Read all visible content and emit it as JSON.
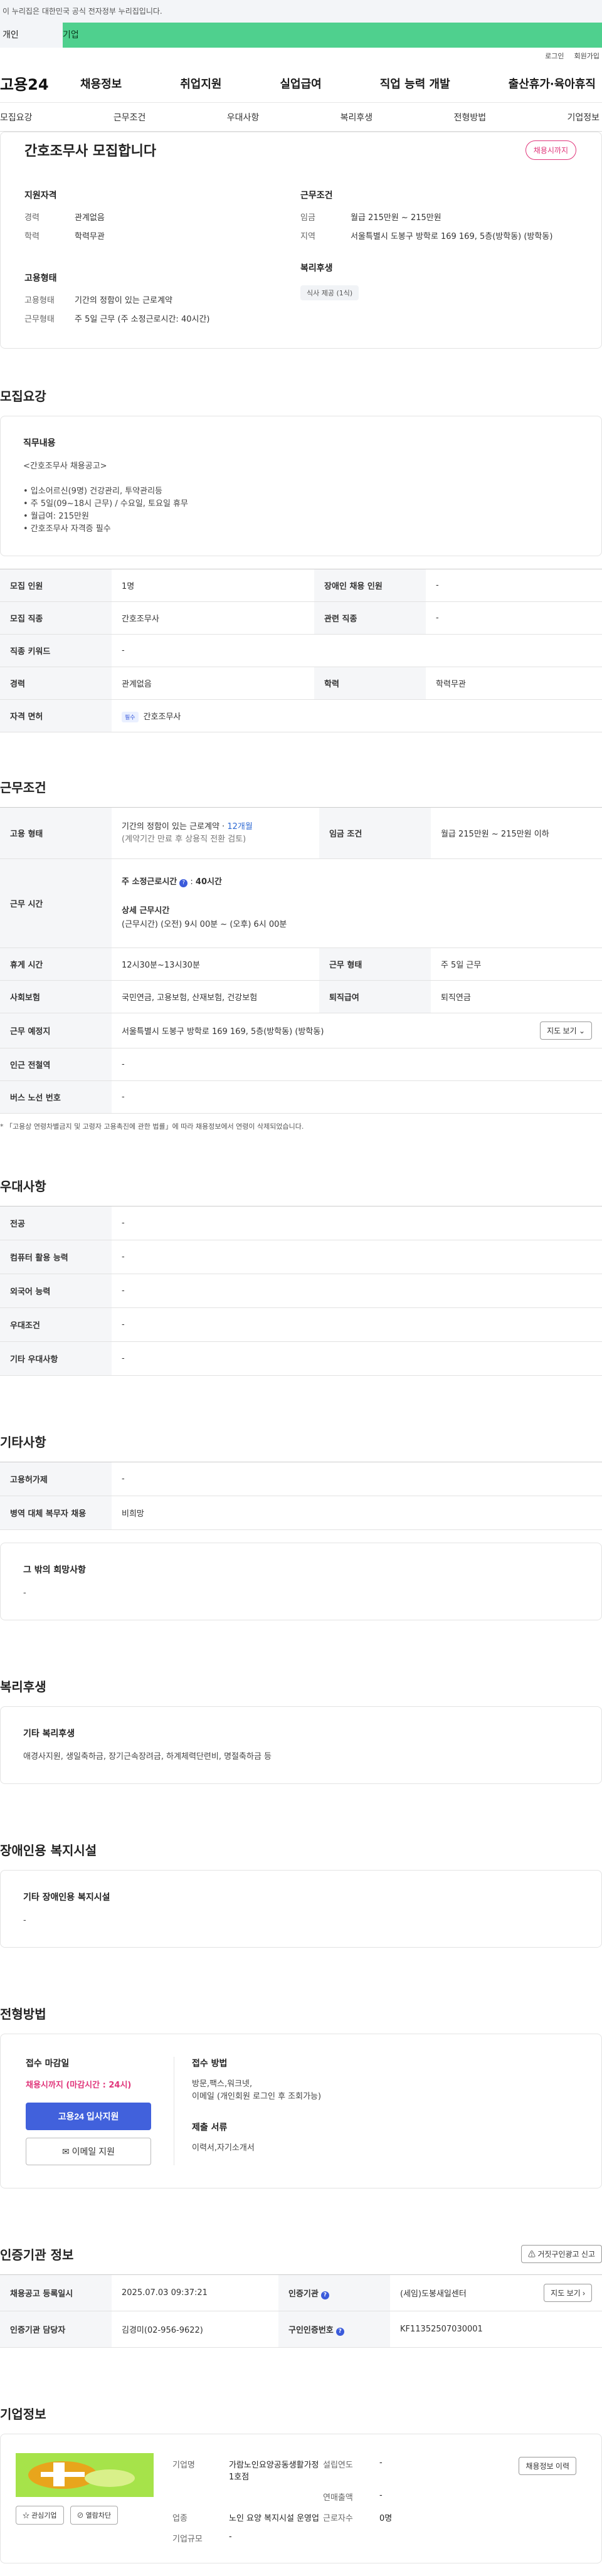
{
  "gov_banner": "이 누리집은 대한민국 공식 전자정부 누리집입니다.",
  "top_tabs": {
    "personal": "개인",
    "company": "기업"
  },
  "util": {
    "login": "로그인",
    "join": "회원가입"
  },
  "logo": "고용24",
  "nav": [
    "채용정보",
    "취업지원",
    "실업급여",
    "직업 능력 개발",
    "출산휴가·육아휴직"
  ],
  "anchor_tabs": [
    "모집요강",
    "근무조건",
    "우대사항",
    "복리후생",
    "전형방법",
    "기업정보"
  ],
  "job": {
    "title": "간호조무사 모집합니다",
    "deadline_badge": "채용시까지",
    "qual_title": "지원자격",
    "career_k": "경력",
    "career_v": "관계없음",
    "edu_k": "학력",
    "edu_v": "학력무관",
    "employ_title": "고용형태",
    "employ_k": "고용형태",
    "employ_v": "기간의 정함이 있는 근로계약",
    "work_k": "근무형태",
    "work_v": "주 5일 근무 (주 소정근로시간: 40시간)",
    "cond_title": "근무조건",
    "wage_k": "임금",
    "wage_v": "월급 215만원 ~ 215만원",
    "region_k": "지역",
    "region_v": "서울특별시 도봉구 방학로 169 169, 5층(방학동) (방학동)",
    "welfare_title": "복리후생",
    "welfare_chip": "식사 제공 (1식)"
  },
  "recruit": {
    "section_title": "모집요강",
    "duty_title": "직무내용",
    "duty_lines": [
      "<간호조무사 채용공고>",
      "",
      "• 입소어르신(9명) 건강관리, 투약관리등",
      "• 주 5일(09~18시 근무) / 수요일, 토요일 휴무",
      "• 월급여: 215만원",
      "• 간호조무사 자격증 필수"
    ],
    "table": {
      "r1k1": "모집 인원",
      "r1v1": "1명",
      "r1k2": "장애인 채용 인원",
      "r1v2": "-",
      "r2k1": "모집 직종",
      "r2v1": "간호조무사",
      "r2k2": "관련 직종",
      "r2v2": "-",
      "r3k1": "직종 키워드",
      "r3v1": "-",
      "r4k1": "경력",
      "r4v1": "관계없음",
      "r4k2": "학력",
      "r4v2": "학력무관",
      "r5k1": "자격 면허",
      "r5badge": "필수",
      "r5v1": "간호조무사"
    }
  },
  "work": {
    "section_title": "근무조건",
    "employ_k": "고용 형태",
    "employ_v1": "기간의 정함이 있는 근로계약 · ",
    "employ_period": "12개월",
    "employ_v2": "(계약기간 만료 후 상용직 전환 검토)",
    "wage_k": "임금 조건",
    "wage_v": "월급 215만원 ~ 215만원 이하",
    "time_k": "근무 시간",
    "time_hours_label": "주 소정근로시간",
    "time_hours_v": "40시간",
    "time_detail_label": "상세 근무시간",
    "time_detail_v": "(근무시간) (오전) 9시 00분 ~ (오후) 6시 00분",
    "break_k": "휴게 시간",
    "break_v": "12시30분~13시30분",
    "form_k": "근무 형태",
    "form_v": "주 5일 근무",
    "ins_k": "사회보험",
    "ins_v": "국민연금, 고용보험, 산재보험, 건강보험",
    "ret_k": "퇴직급여",
    "ret_v": "퇴직연금",
    "place_k": "근무 예정지",
    "place_v": "서울특별시 도봉구 방학로 169 169, 5층(방학동) (방학동)",
    "map_btn": "지도 보기",
    "subway_k": "인근 전철역",
    "subway_v": "-",
    "bus_k": "버스 노선 번호",
    "bus_v": "-",
    "note": "* 「고용상 연령차별금지 및 고령자 고용촉진에 관한 법률」에 따라 채용정보에서 연령이 삭제되었습니다."
  },
  "pref": {
    "section_title": "우대사항",
    "rows": [
      {
        "k": "전공",
        "v": "-"
      },
      {
        "k": "컴퓨터 활용 능력",
        "v": "-"
      },
      {
        "k": "외국어 능력",
        "v": "-"
      },
      {
        "k": "우대조건",
        "v": "-"
      },
      {
        "k": "기타 우대사항",
        "v": "-"
      }
    ]
  },
  "etc": {
    "section_title": "기타사항",
    "r1k": "고용허가제",
    "r1v": "-",
    "r2k": "병역 대체 복무자 채용",
    "r2v": "비희망",
    "box_title": "그 밖의 희망사항",
    "box_v": "-"
  },
  "welfare": {
    "section_title": "복리후생",
    "box_title": "기타 복리후생",
    "box_v": "애경사지원, 생일축하금, 장기근속장려금, 하계체력단련비, 명절축하금 등"
  },
  "disabled": {
    "section_title": "장애인용 복지시설",
    "box_title": "기타 장애인용 복지시설",
    "box_v": "-"
  },
  "apply": {
    "section_title": "전형방법",
    "deadline_title": "접수 마감일",
    "deadline_v": "채용시까지 (마감시간 : 24시)",
    "apply_btn": "고용24 입사지원",
    "email_btn": "이메일 지원",
    "method_title": "접수 방법",
    "method_v1": "방문,팩스,워크넷,",
    "method_v2": "이메일 (개인회원 로그인 후 조회가능)",
    "docs_title": "제출 서류",
    "docs_v": "이력서,자기소개서"
  },
  "cert": {
    "section_title": "인증기관 정보",
    "report_btn": "거짓구인광고 신고",
    "r1k1": "채용공고 등록일시",
    "r1v1": "2025.07.03 09:37:21",
    "r1k2": "인증기관",
    "r1v2": "(세임)도봉새일센터",
    "map_btn": "지도 보기",
    "r2k1": "인증기관 담당자",
    "r2v1": "김경미(02-956-9622)",
    "r2k2": "구인인증번호",
    "r2v2": "KF11352507030001"
  },
  "company": {
    "section_title": "기업정보",
    "btn_interest": "관심기업",
    "btn_block": "열람차단",
    "name_k": "기업명",
    "name_v": "가람노인요양공동생활가정1호점",
    "year_k": "설립연도",
    "year_v": "-",
    "sales_k": "연매출액",
    "sales_v": "-",
    "ind_k": "업종",
    "ind_v": "노인 요양 복지시설 운영업",
    "emp_k": "근로자수",
    "emp_v": "0명",
    "size_k": "기업규모",
    "size_v": "-",
    "view_btn": "채용정보 이력"
  },
  "colors": {
    "accent": "#4161dc",
    "pink": "#e0357a",
    "green": "#4fd08e"
  }
}
